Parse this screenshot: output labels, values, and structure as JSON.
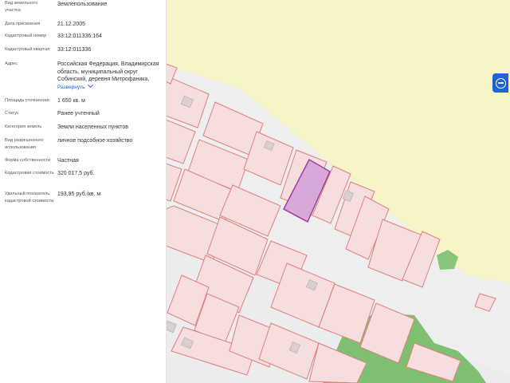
{
  "panel": {
    "fields": [
      {
        "label": "Вид земельного участка",
        "value": "Землепользование"
      },
      {
        "label": "Дата присвоения",
        "value": "21.12.2005"
      },
      {
        "label": "Кадастровый номер",
        "value": "33:12:011336:164"
      },
      {
        "label": "Кадастровый квартал",
        "value": "33:12:011336"
      },
      {
        "label": "Адрес",
        "value": "Российская Федерация, Владимирская область, муниципальный округ Собинский, деревня Митрофаника,"
      },
      {
        "label": "Площадь уточненная",
        "value": "1 650 кв. м"
      },
      {
        "label": "Статус",
        "value": "Ранее учтенный"
      },
      {
        "label": "Категория земель",
        "value": "Земли населенных пунктов"
      },
      {
        "label": "Вид разрешенного использования",
        "value": "личное подсобное хозяйство"
      },
      {
        "label": "Форма собственности",
        "value": "Частная"
      },
      {
        "label": "Кадастровая стоимость",
        "value": "320 017,5 руб."
      },
      {
        "label": "Удельный показатель кадастровой стоимости",
        "value": "193,95 руб./кв. м"
      }
    ],
    "expand_link": "Развернуть"
  },
  "map": {
    "colors": {
      "field": "#f6f4c6",
      "settlement": "#eeeeee",
      "parcel_fill": "#f7dede",
      "parcel_stroke": "#e27f7f",
      "selected_fill": "#d8a8d8",
      "selected_stroke": "#9b3f9b",
      "forest": "#7fbf72",
      "building": "#d9cfcf",
      "button": "#1e63d6"
    },
    "side_button_icon": "map-layers-icon"
  }
}
